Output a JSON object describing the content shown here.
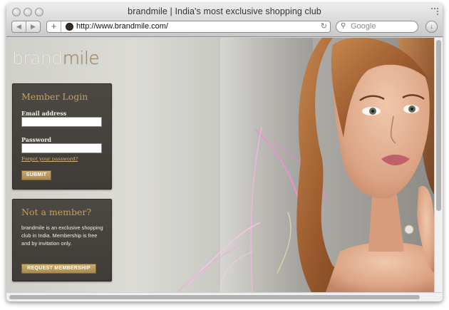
{
  "browser": {
    "title": "brandmile | India's most exclusive shopping club",
    "url": "http://www.brandmile.com/",
    "search_placeholder": "Google",
    "nav": {
      "back": "◀",
      "forward": "▶",
      "add": "+"
    },
    "reload_symbol": "↻",
    "download_symbol": "↓",
    "search_symbol": "⚲"
  },
  "logo": {
    "part1": "brand",
    "part2": "mile"
  },
  "login": {
    "heading": "Member Login",
    "email_label": "Email address",
    "email_value": "",
    "password_label": "Password",
    "password_value": "",
    "forgot": "Forgot your password?",
    "submit": "SUBMIT"
  },
  "signup": {
    "heading": "Not a member?",
    "description": "brandmile is an exclusive shopping club in India. Membership is free and by invitation only.",
    "button": "REQUEST MEMBERSHIP"
  },
  "colors": {
    "accent": "#c39f62",
    "panel_bg": "#46433e",
    "button_gold": "#b99a60"
  }
}
